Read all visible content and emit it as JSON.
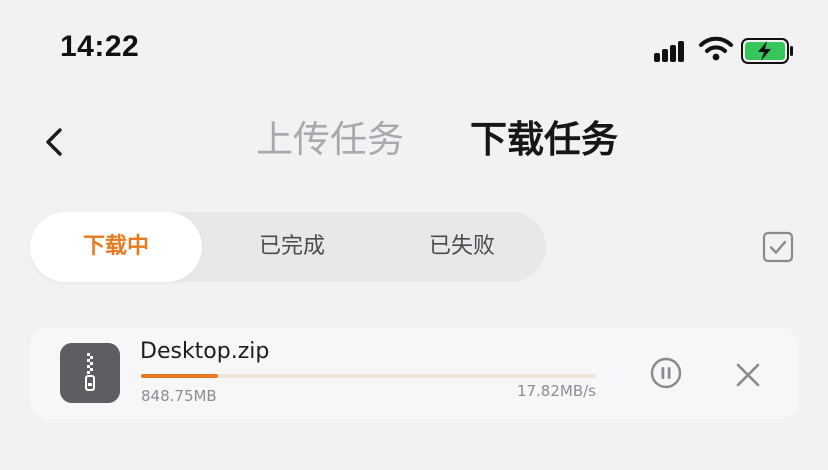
{
  "status_bar": {
    "time": "14:22",
    "icons": [
      "signal-icon",
      "wifi-icon",
      "battery-charging-icon"
    ],
    "battery_color": "#35c759"
  },
  "header": {
    "back_icon": "chevron-left-icon",
    "tabs": [
      {
        "label": "上传任务",
        "active": false
      },
      {
        "label": "下载任务",
        "active": true
      }
    ]
  },
  "filter": {
    "segments": [
      {
        "label": "下载中",
        "active": true
      },
      {
        "label": "已完成",
        "active": false
      },
      {
        "label": "已失败",
        "active": false
      }
    ],
    "select_icon": "checkbox-icon"
  },
  "tasks": [
    {
      "file_name": "Desktop.zip",
      "file_icon": "zip-file-icon",
      "size": "848.75MB",
      "speed": "17.82MB/s",
      "progress": 0.17,
      "actions": [
        "pause-icon",
        "close-icon"
      ]
    }
  ],
  "colors": {
    "accent": "#e8791f",
    "background": "#f2f2f4",
    "inactive_text": "#a9a9ad"
  }
}
